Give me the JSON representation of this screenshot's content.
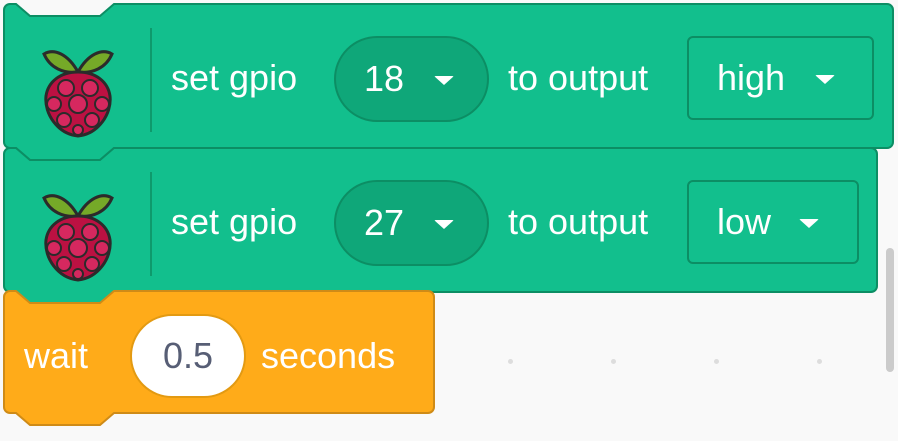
{
  "theme": {
    "gpio_block_color": "#12bf8d",
    "gpio_block_border": "#0c8e64",
    "wait_block_color": "#ffab19",
    "wait_block_border": "#cf8b17",
    "workspace_background": "#f9f9f9"
  },
  "blocks": [
    {
      "type": "gpio-output",
      "icon": "raspberry-pi-icon",
      "label_set": "set gpio",
      "pin": "18",
      "label_to": "to output",
      "level": "high"
    },
    {
      "type": "gpio-output",
      "icon": "raspberry-pi-icon",
      "label_set": "set gpio",
      "pin": "27",
      "label_to": "to output",
      "level": "low"
    },
    {
      "type": "wait",
      "label_wait": "wait",
      "duration": "0.5",
      "label_seconds": "seconds"
    }
  ],
  "dropdown_icon": "caret-down-icon"
}
